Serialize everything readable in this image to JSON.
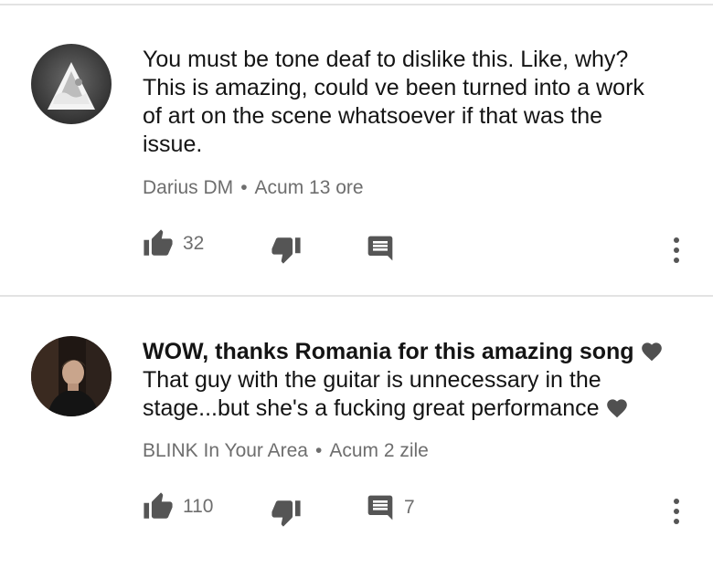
{
  "comments": [
    {
      "text_lines": [
        "You must be tone deaf to dislike this. Like, why?",
        "This is amazing, could ve been turned into a work",
        "of art on the scene whatsoever if that was the",
        "issue."
      ],
      "author": "Darius DM",
      "separator": "•",
      "time": "Acum 13 ore",
      "likes": "32",
      "replies": ""
    },
    {
      "text_lines": [
        "WOW, thanks Romania for this amazing song",
        "That guy with the guitar is unnecessary in the",
        "stage...but she's a fucking great performance"
      ],
      "author": "BLINK In Your Area",
      "separator": "•",
      "time": "Acum 2 zile",
      "likes": "110",
      "replies": "7"
    }
  ],
  "icons": {
    "like": "thumbs-up-icon",
    "dislike": "thumbs-down-icon",
    "reply": "reply-comment-icon",
    "more": "more-vert-icon",
    "heart": "black-heart-icon"
  },
  "colors": {
    "text": "#141414",
    "meta": "#6e6e6e",
    "icon": "#555555",
    "divider": "#e3e3e3"
  }
}
